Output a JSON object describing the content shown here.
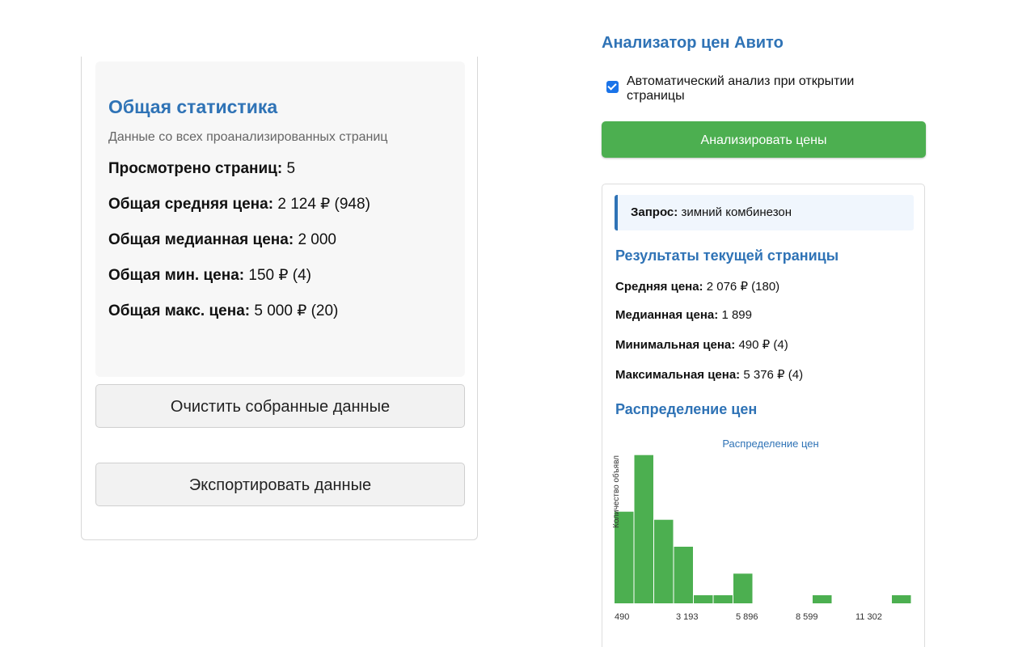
{
  "global_stats": {
    "title": "Общая статистика",
    "subtitle": "Данные со всех проанализированных страниц",
    "items": [
      {
        "label": "Просмотрено страниц:",
        "value": "5"
      },
      {
        "label": "Общая средняя цена:",
        "value": "2 124 ₽ (948)"
      },
      {
        "label": "Общая медианная цена:",
        "value": "2 000"
      },
      {
        "label": "Общая мин. цена:",
        "value": "150 ₽ (4)"
      },
      {
        "label": "Общая макс. цена:",
        "value": "5 000 ₽ (20)"
      }
    ],
    "clear_button": "Очистить собранные данные",
    "export_button": "Экспортировать данные"
  },
  "analyzer": {
    "title": "Анализатор цен Авито",
    "auto_checkbox_label": "Автоматический анализ при открытии страницы",
    "auto_checked": true,
    "analyze_button": "Анализировать цены",
    "query_label": "Запрос:",
    "query_value": "зимний комбинезон",
    "results_title": "Результаты текущей страницы",
    "results": [
      {
        "label": "Средняя цена:",
        "value": "2 076 ₽ (180)"
      },
      {
        "label": "Медианная цена:",
        "value": "1 899"
      },
      {
        "label": "Минимальная цена:",
        "value": "490 ₽ (4)"
      },
      {
        "label": "Максимальная цена:",
        "value": "5 376 ₽ (4)"
      }
    ],
    "distribution_title": "Распределение цен"
  },
  "colors": {
    "accent": "#2f73b6",
    "green": "#4caf50",
    "checkbox": "#1a73e8"
  },
  "chart_data": {
    "type": "bar",
    "title": "Распределение цен",
    "ylabel": "Количество объявл",
    "x_tick_labels": [
      "490",
      "3 193",
      "5 896",
      "8 599",
      "11 302"
    ],
    "bin_count": 16,
    "values": [
      34,
      55,
      31,
      21,
      3,
      3,
      11,
      0,
      0,
      0,
      3,
      0,
      0,
      0,
      3
    ],
    "ylim": [
      0,
      60
    ],
    "color": "#4caf50"
  }
}
